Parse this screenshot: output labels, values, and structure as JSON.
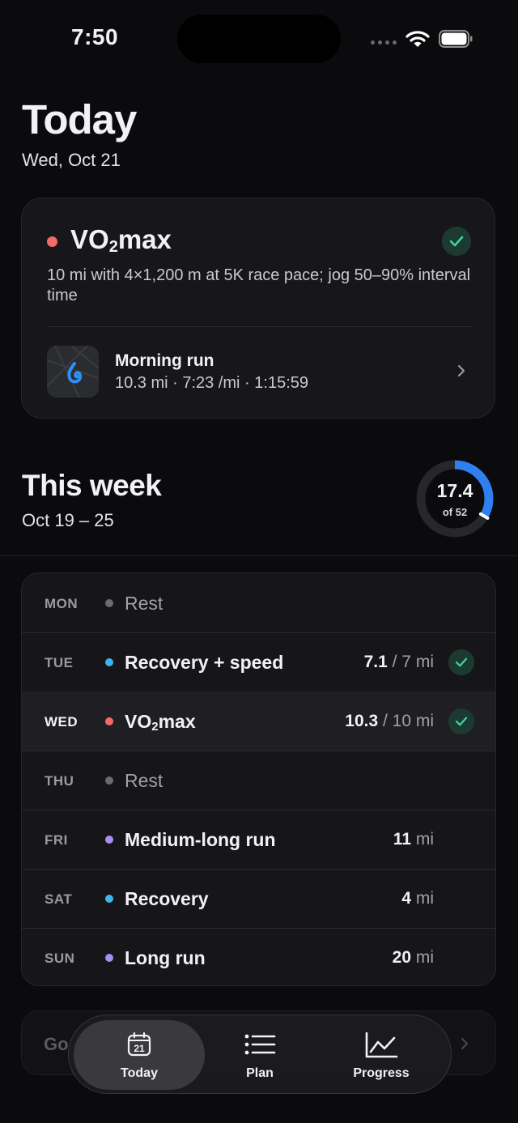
{
  "status_bar": {
    "time": "7:50"
  },
  "header": {
    "title": "Today",
    "date": "Wed, Oct 21"
  },
  "today_workout": {
    "title_prefix": "VO",
    "title_sub": "2",
    "title_suffix": "max",
    "description": "10 mi with 4×1,200 m at 5K race pace; jog 50–90% interval time",
    "color": "#f26b6b",
    "completed": true,
    "activity": {
      "title": "Morning run",
      "stats": "10.3 mi · 7:23 /mi · 1:15:59"
    }
  },
  "week": {
    "title": "This week",
    "range": "Oct 19 – 25",
    "progress_value": "17.4",
    "progress_of": "of 52",
    "progress_fraction": 0.335,
    "ring_color": "#2f7ff0",
    "days": [
      {
        "day": "MON",
        "name": "Rest",
        "rest": true,
        "color": "#6b6b70"
      },
      {
        "day": "TUE",
        "name": "Recovery + speed",
        "done": "7.1",
        "target": " / 7 mi",
        "completed": true,
        "color": "#3fb4ee"
      },
      {
        "day": "WED",
        "name_prefix": "VO",
        "name_sub": "2",
        "name_suffix": "max",
        "done": "10.3",
        "target": " / 10 mi",
        "completed": true,
        "today": true,
        "color": "#f26b6b"
      },
      {
        "day": "THU",
        "name": "Rest",
        "rest": true,
        "color": "#6b6b70"
      },
      {
        "day": "FRI",
        "name": "Medium-long run",
        "done": "11",
        "target": " mi",
        "color": "#a98cf0"
      },
      {
        "day": "SAT",
        "name": "Recovery",
        "done": "4",
        "target": " mi",
        "color": "#3fb4ee"
      },
      {
        "day": "SUN",
        "name": "Long run",
        "done": "20",
        "target": " mi",
        "color": "#a98cf0"
      }
    ]
  },
  "next_card": {
    "text": "Go"
  },
  "tabbar": {
    "calendar_day": "21",
    "tabs": [
      {
        "label": "Today",
        "icon": "calendar-icon",
        "active": true
      },
      {
        "label": "Plan",
        "icon": "list-icon"
      },
      {
        "label": "Progress",
        "icon": "chart-icon"
      }
    ]
  }
}
